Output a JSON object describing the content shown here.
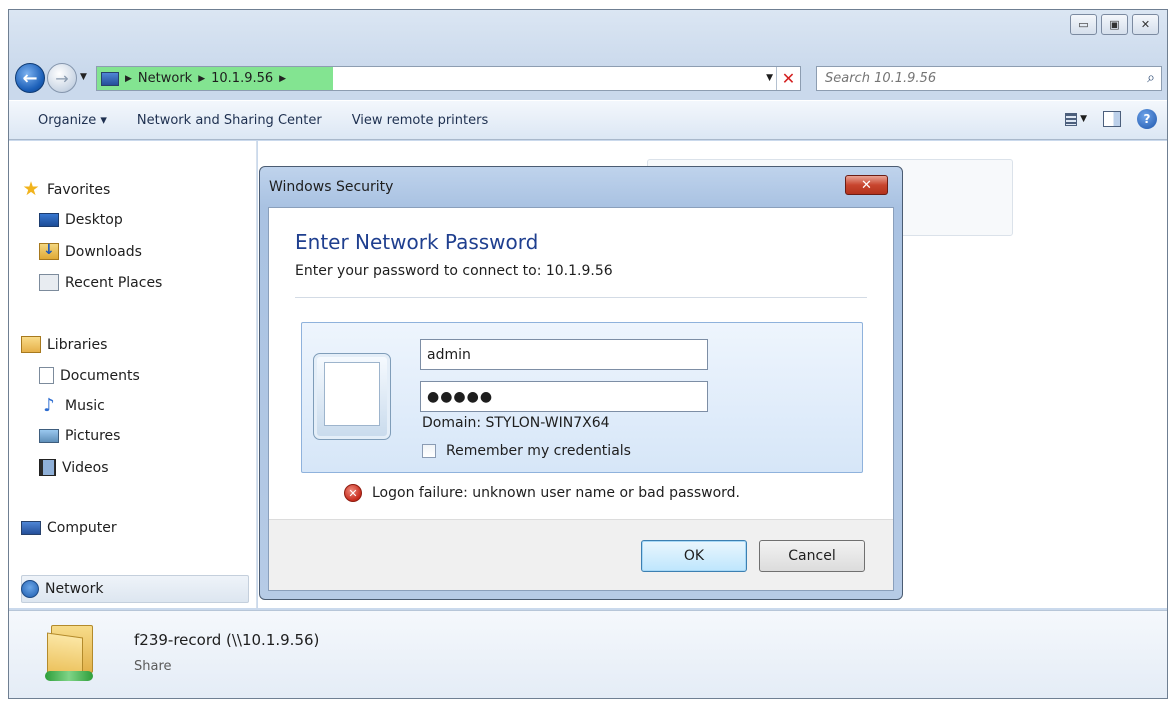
{
  "window": {
    "controls": {
      "minimize": "▭",
      "maximize": "▣",
      "close": "✕"
    }
  },
  "addressbar": {
    "crumbs": [
      "Network",
      "10.1.9.56"
    ],
    "stop_glyph": "✕"
  },
  "search": {
    "placeholder": "Search 10.1.9.56"
  },
  "toolbar": {
    "items": [
      "Organize ▾",
      "Network and Sharing Center",
      "View remote printers"
    ],
    "help_glyph": "?"
  },
  "sidebar": {
    "favorites": {
      "label": "Favorites",
      "items": [
        "Desktop",
        "Downloads",
        "Recent Places"
      ]
    },
    "libraries": {
      "label": "Libraries",
      "items": [
        "Documents",
        "Music",
        "Pictures",
        "Videos"
      ]
    },
    "computer": "Computer",
    "network": "Network"
  },
  "details": {
    "name": "f239-record (\\\\10.1.9.56)",
    "type": "Share"
  },
  "dialog": {
    "title": "Windows Security",
    "close_glyph": "✕",
    "heading": "Enter Network Password",
    "subtitle": "Enter your password to connect to: 10.1.9.56",
    "username": "admin",
    "password": "●●●●●",
    "domain": "Domain: STYLON-WIN7X64",
    "remember_label": "Remember my credentials",
    "error": "Logon failure: unknown user name or bad password.",
    "ok_label": "OK",
    "cancel_label": "Cancel"
  },
  "colors": {
    "dialog_heading": "#1f3f8f",
    "address_progress": "#83e491",
    "close_button": "#c8452e"
  },
  "icons": {
    "back": "back-arrow-icon",
    "forward": "forward-arrow-icon",
    "favorites": "star-icon",
    "network": "network-globe-icon",
    "error": "error-x-icon"
  }
}
